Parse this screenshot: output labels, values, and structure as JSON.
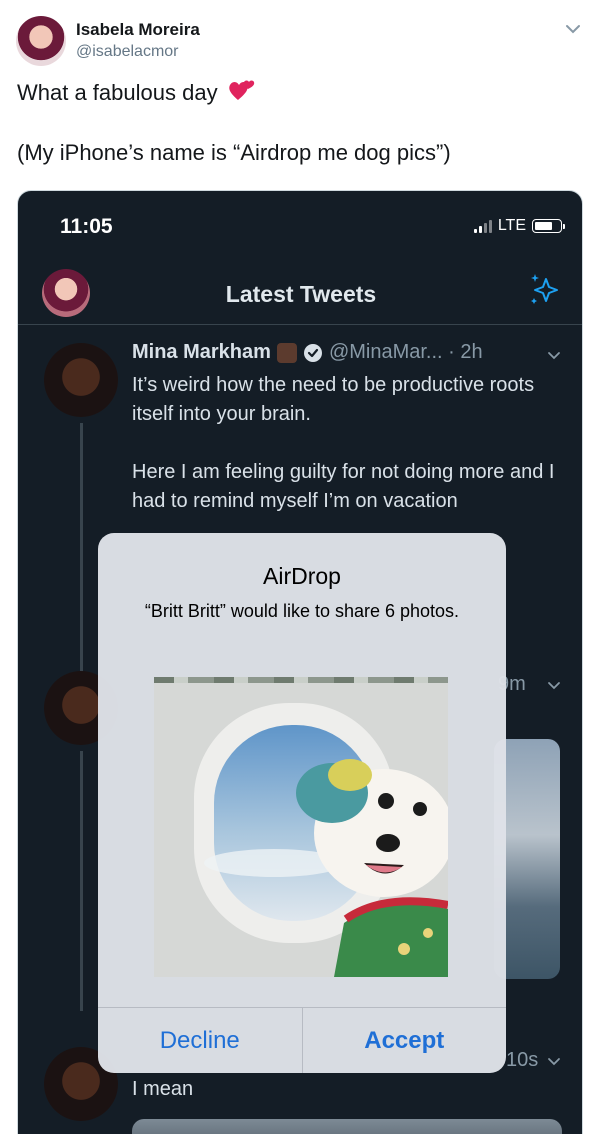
{
  "tweet": {
    "author_name": "Isabela Moreira",
    "author_handle": "@isabelacmor",
    "line1": "What a fabulous day",
    "line2": "(My iPhone’s name is “Airdrop me dog pics”)"
  },
  "phone": {
    "status": {
      "time": "11:05",
      "network": "LTE"
    },
    "nav": {
      "title": "Latest Tweets"
    },
    "feed": {
      "first_tweet": {
        "name": "Mina Markham",
        "meta": "@MinaMar... · 2h",
        "paragraphs": [
          "It’s weird how the need to be productive roots itself into your brain.",
          "Here I am feeling guilty for not doing more and I had to remind myself I’m on vacation"
        ]
      },
      "second_tweet_time": "9m",
      "third_tweet_time": "10s",
      "third_tweet_text": "I mean"
    },
    "airdrop": {
      "title": "AirDrop",
      "message": "“Britt Britt” would like to share 6 photos.",
      "decline_label": "Decline",
      "accept_label": "Accept"
    }
  },
  "colors": {
    "dark_bg": "#141d26",
    "link_blue": "#1f6fd6",
    "heart": "#e0245e",
    "twitter_blue": "#1da1f2"
  }
}
